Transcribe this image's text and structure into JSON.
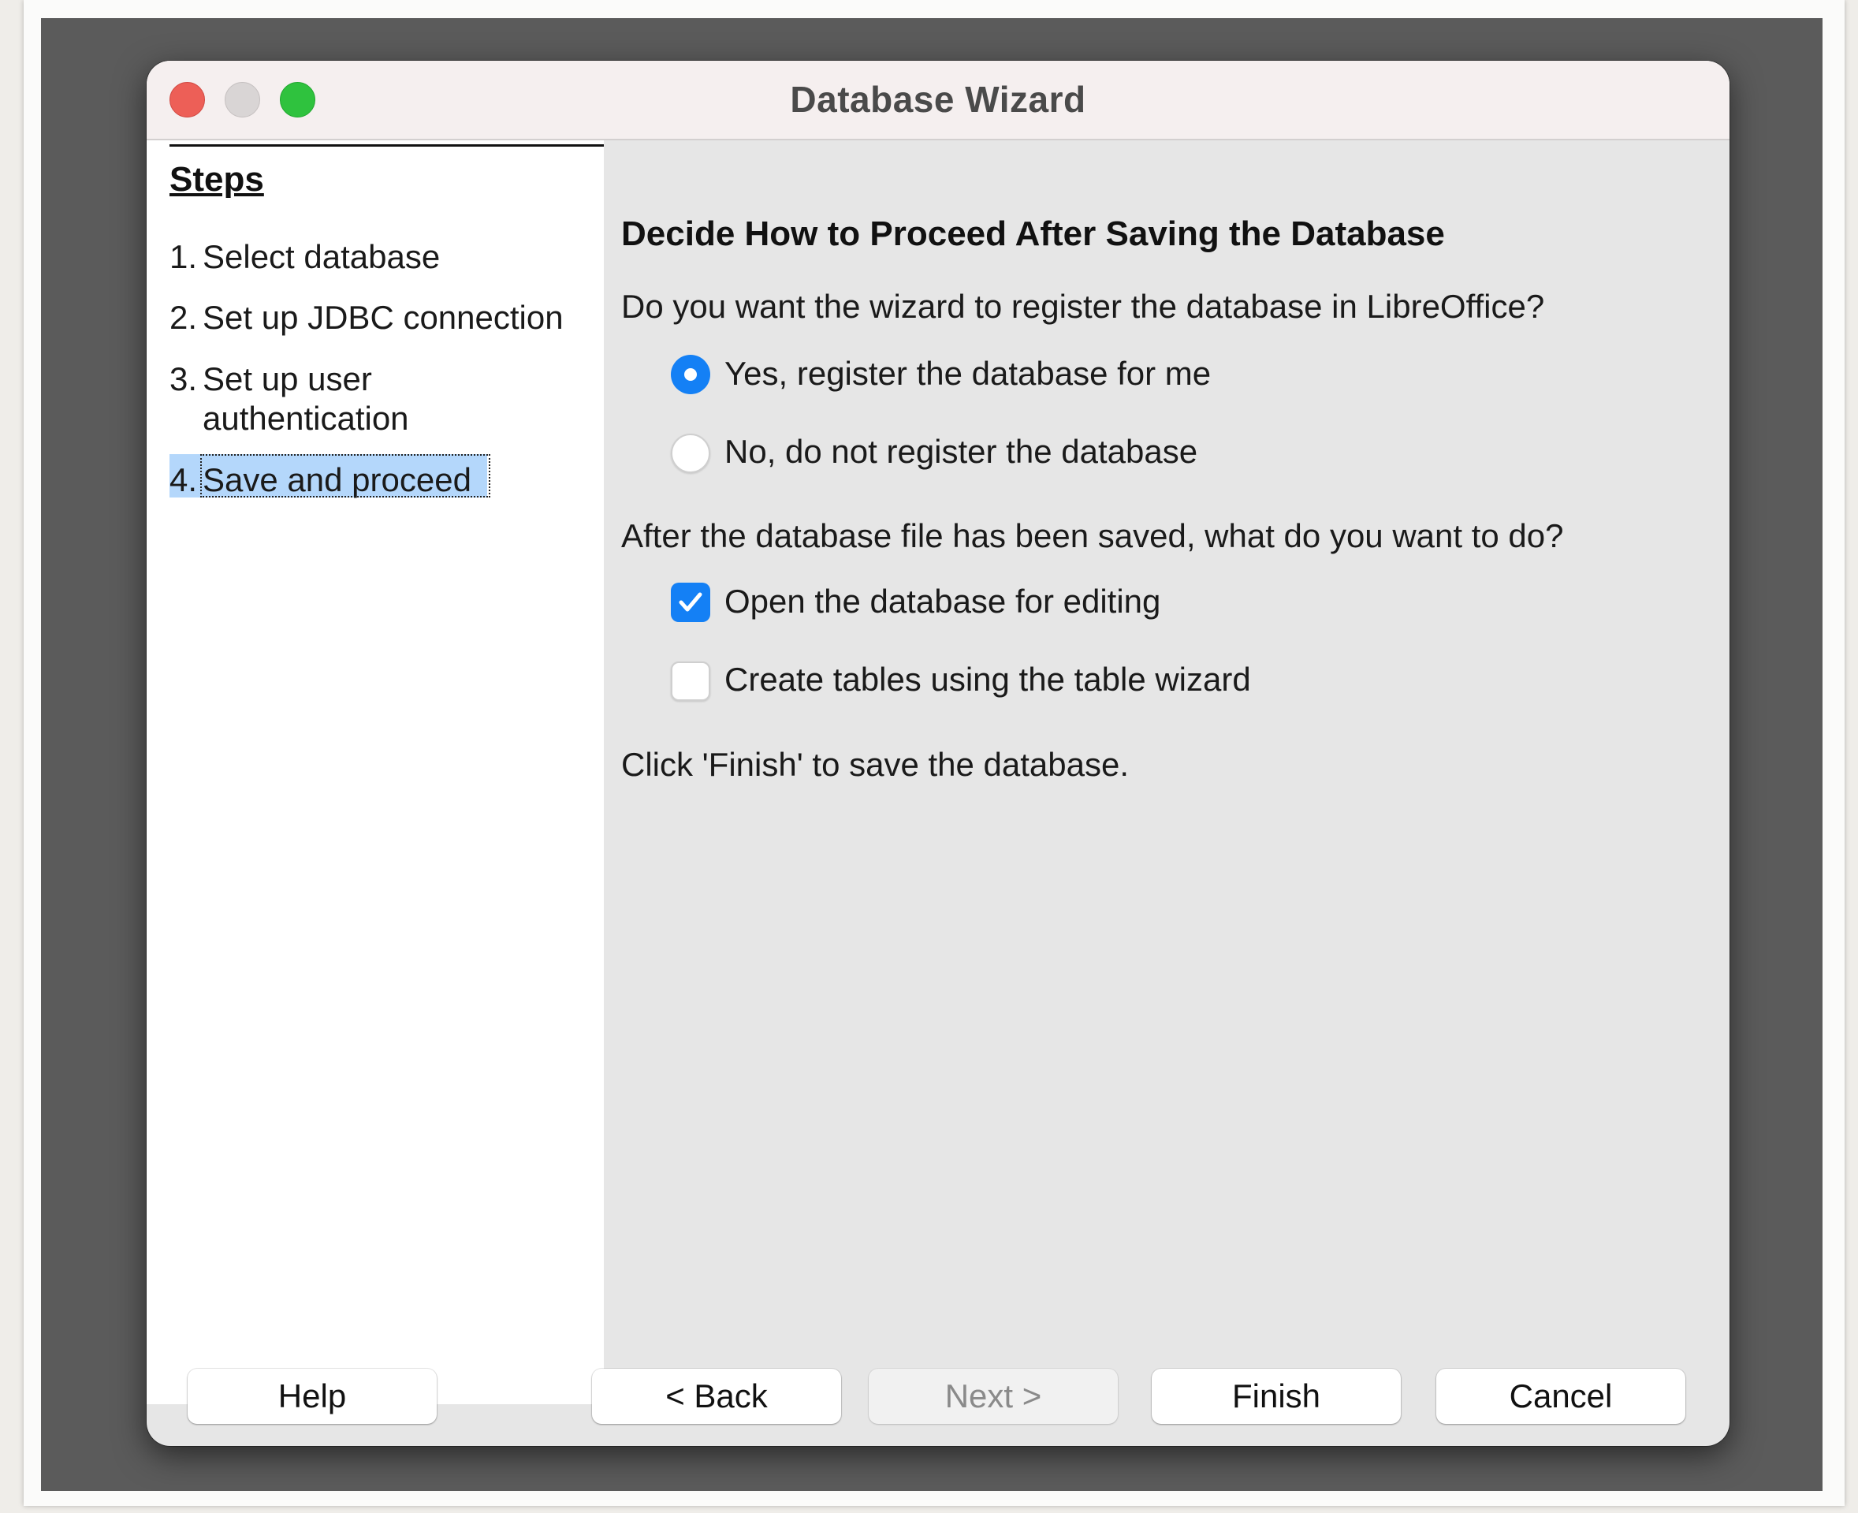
{
  "window": {
    "title": "Database Wizard"
  },
  "steps": {
    "heading": "Steps",
    "items": [
      {
        "num": "1.",
        "label": "Select database",
        "active": false
      },
      {
        "num": "2.",
        "label": "Set up JDBC connection",
        "active": false
      },
      {
        "num": "3.",
        "label": "Set up user",
        "label_line2": "authentication",
        "active": false
      },
      {
        "num": "4.",
        "label": "Save and proceed",
        "active": true
      }
    ]
  },
  "content": {
    "heading": "Decide How to Proceed After Saving the Database",
    "register_question": "Do you want the wizard to register the database in LibreOffice?",
    "register_options": [
      {
        "label": "Yes, register the database for me",
        "selected": true
      },
      {
        "label": "No, do not register the database",
        "selected": false
      }
    ],
    "after_question": "After the database file has been saved, what do you want to do?",
    "after_options": [
      {
        "label": "Open the database for editing",
        "checked": true
      },
      {
        "label": "Create tables using the table wizard",
        "checked": false
      }
    ],
    "footer_note": "Click 'Finish' to save the database."
  },
  "buttons": {
    "help": "Help",
    "back": "< Back",
    "next": "Next >",
    "finish": "Finish",
    "cancel": "Cancel"
  },
  "colors": {
    "accent": "#1480f5",
    "selection_highlight": "#b4d7fb",
    "close": "#ed5f57",
    "maximize": "#2fc23e"
  }
}
